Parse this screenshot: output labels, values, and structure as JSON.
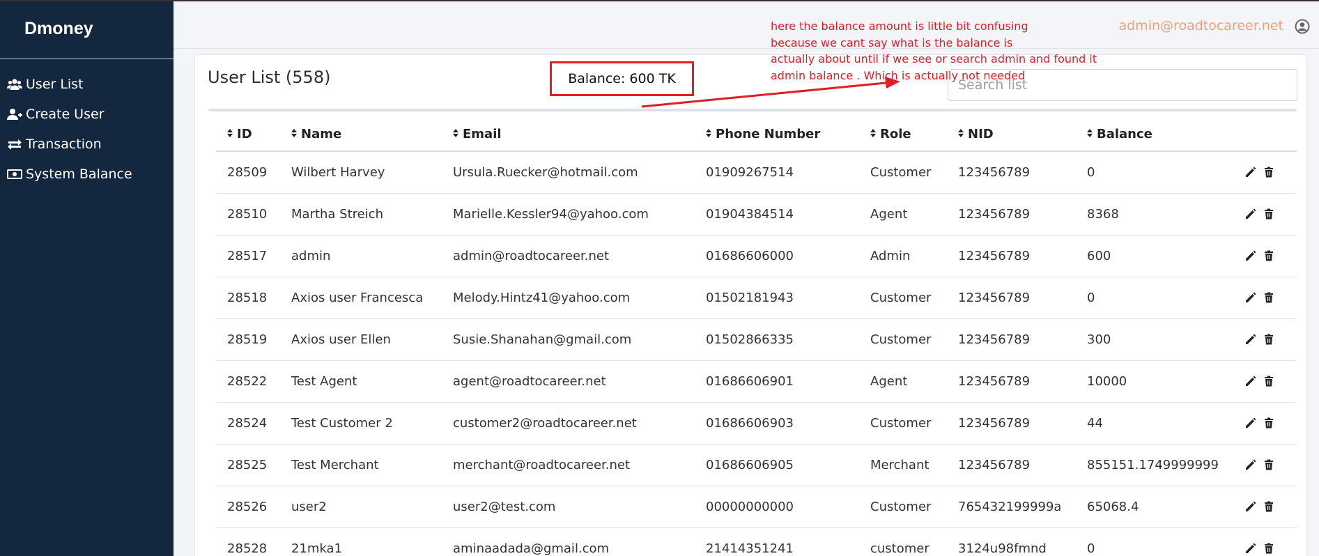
{
  "app": {
    "brand": "Dmoney",
    "user_email": "admin@roadtocareer.net"
  },
  "sidebar": {
    "items": [
      {
        "label": "User List",
        "icon": "users-icon"
      },
      {
        "label": "Create User",
        "icon": "user-plus-icon"
      },
      {
        "label": "Transaction",
        "icon": "exchange-icon"
      },
      {
        "label": "System Balance",
        "icon": "money-icon"
      }
    ]
  },
  "main": {
    "title": "User List (558)",
    "balance": "Balance: 600 TK",
    "search_placeholder": "Search list",
    "columns": [
      "ID",
      "Name",
      "Email",
      "Phone Number",
      "Role",
      "NID",
      "Balance"
    ],
    "rows": [
      {
        "id": "28509",
        "name": "Wilbert Harvey",
        "email": "Ursula.Ruecker@hotmail.com",
        "phone": "01909267514",
        "role": "Customer",
        "nid": "123456789",
        "balance": "0"
      },
      {
        "id": "28510",
        "name": "Martha Streich",
        "email": "Marielle.Kessler94@yahoo.com",
        "phone": "01904384514",
        "role": "Agent",
        "nid": "123456789",
        "balance": "8368"
      },
      {
        "id": "28517",
        "name": "admin",
        "email": "admin@roadtocareer.net",
        "phone": "01686606000",
        "role": "Admin",
        "nid": "123456789",
        "balance": "600"
      },
      {
        "id": "28518",
        "name": "Axios user Francesca",
        "email": "Melody.Hintz41@yahoo.com",
        "phone": "01502181943",
        "role": "Customer",
        "nid": "123456789",
        "balance": "0"
      },
      {
        "id": "28519",
        "name": "Axios user Ellen",
        "email": "Susie.Shanahan@gmail.com",
        "phone": "01502866335",
        "role": "Customer",
        "nid": "123456789",
        "balance": "300"
      },
      {
        "id": "28522",
        "name": "Test Agent",
        "email": "agent@roadtocareer.net",
        "phone": "01686606901",
        "role": "Agent",
        "nid": "123456789",
        "balance": "10000"
      },
      {
        "id": "28524",
        "name": "Test Customer 2",
        "email": "customer2@roadtocareer.net",
        "phone": "01686606903",
        "role": "Customer",
        "nid": "123456789",
        "balance": "44"
      },
      {
        "id": "28525",
        "name": "Test Merchant",
        "email": "merchant@roadtocareer.net",
        "phone": "01686606905",
        "role": "Merchant",
        "nid": "123456789",
        "balance": "855151.1749999999"
      },
      {
        "id": "28526",
        "name": "user2",
        "email": "user2@test.com",
        "phone": "00000000000",
        "role": "Customer",
        "nid": "765432199999a",
        "balance": "65068.4"
      },
      {
        "id": "28528",
        "name": "21mka1",
        "email": "aminaadada@gmail.com",
        "phone": "21414351241",
        "role": "customer",
        "nid": "3124u98fmnd",
        "balance": "0"
      }
    ]
  },
  "annotation": {
    "text": "here the balance amount is little bit confusing\nbecause we cant say what is the balance is\nactually about until if we see or search admin  and found it\nadmin balance . Which is actually not needed",
    "color": "#e31b23"
  }
}
